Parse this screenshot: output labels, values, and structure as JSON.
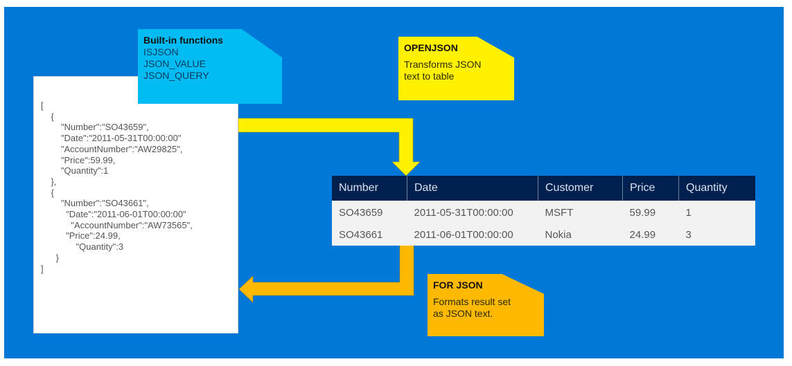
{
  "diagram": {
    "background_color": "#0078d7",
    "json_document": {
      "lines": [
        "[",
        "  {",
        "    \"Number\":\"SO43659\",",
        "    \"Date\":\"2011-05-31T00:00:00\"",
        "    \"AccountNumber\":\"AW29825\",",
        "    \"Price\":59.99,",
        "    \"Quantity\":1",
        "  },",
        "  {",
        "    \"Number\":\"SO43661\",",
        "     \"Date\":\"2011-06-01T00:00:00\"",
        "      \"AccountNumber\":\"AW73565\",",
        "     \"Price\":24.99,",
        "       \"Quantity\":3",
        "   }",
        "]"
      ]
    },
    "notes": {
      "builtin": {
        "title": "Built-in functions",
        "items": [
          "ISJSON",
          "JSON_VALUE",
          "JSON_QUERY"
        ],
        "color": "#00bcf2"
      },
      "openjson": {
        "title": "OPENJSON",
        "lines": [
          "Transforms JSON",
          "text to table"
        ],
        "color": "#fff100"
      },
      "forjson": {
        "title": "FOR JSON",
        "lines": [
          "Formats result set",
          "as JSON text."
        ],
        "color": "#ffb900"
      }
    },
    "arrows": {
      "openjson_arrow_color": "#fff100",
      "forjson_arrow_color": "#ffb900"
    },
    "table": {
      "header_color": "#002050",
      "columns": [
        "Number",
        "Date",
        "Customer",
        "Price",
        "Quantity"
      ],
      "rows": [
        [
          "SO43659",
          "2011-05-31T00:00:00",
          "MSFT",
          "59.99",
          "1"
        ],
        [
          "SO43661",
          "2011-06-01T00:00:00",
          "Nokia",
          "24.99",
          "3"
        ]
      ]
    }
  }
}
